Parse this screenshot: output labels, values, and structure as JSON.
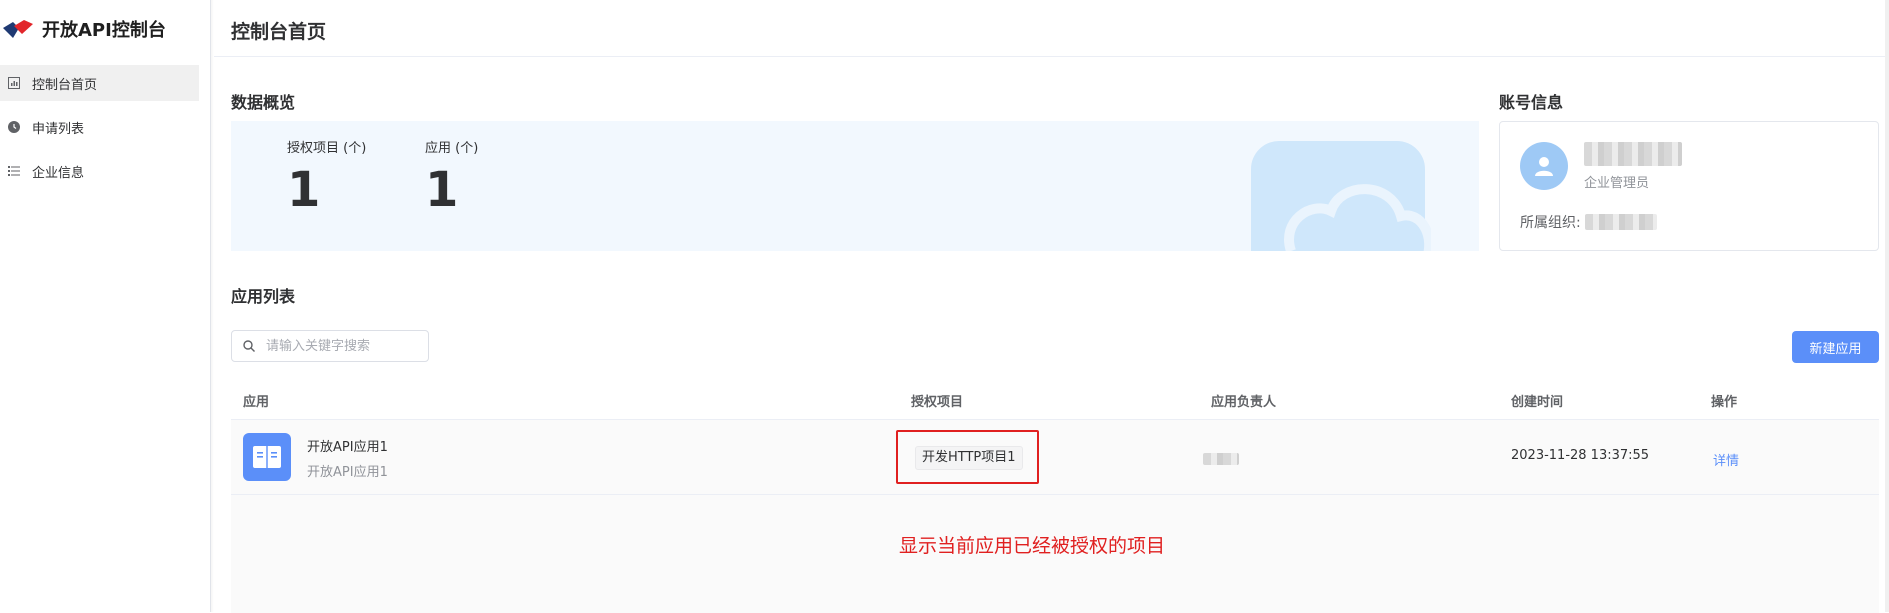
{
  "app": {
    "title": "开放API控制台"
  },
  "sidebar": {
    "items": [
      {
        "label": "控制台首页",
        "icon": "bar-chart-icon",
        "active": true
      },
      {
        "label": "申请列表",
        "icon": "clock-icon",
        "active": false
      },
      {
        "label": "企业信息",
        "icon": "list-icon",
        "active": false
      }
    ]
  },
  "header": {
    "title": "控制台首页"
  },
  "overview": {
    "title": "数据概览",
    "stats": [
      {
        "label": "授权项目 (个)",
        "value": "1"
      },
      {
        "label": "应用 (个)",
        "value": "1"
      }
    ]
  },
  "account": {
    "title": "账号信息",
    "role": "企业管理员",
    "org_label": "所属组织:"
  },
  "app_list": {
    "title": "应用列表",
    "search_placeholder": "请输入关键字搜索",
    "new_button": "新建应用",
    "columns": [
      "应用",
      "授权项目",
      "应用负责人",
      "创建时间",
      "操作"
    ],
    "rows": [
      {
        "name": "开放API应用1",
        "description": "开放API应用1",
        "project_tag": "开发HTTP项目1",
        "created": "2023-11-28 13:37:55",
        "action": "详情"
      }
    ]
  },
  "annotation": {
    "text": "显示当前应用已经被授权的项目",
    "color": "#e02020"
  },
  "colors": {
    "primary": "#5b8ff9",
    "overview_bg": "#f2f8fe",
    "annotation": "#e02020"
  }
}
